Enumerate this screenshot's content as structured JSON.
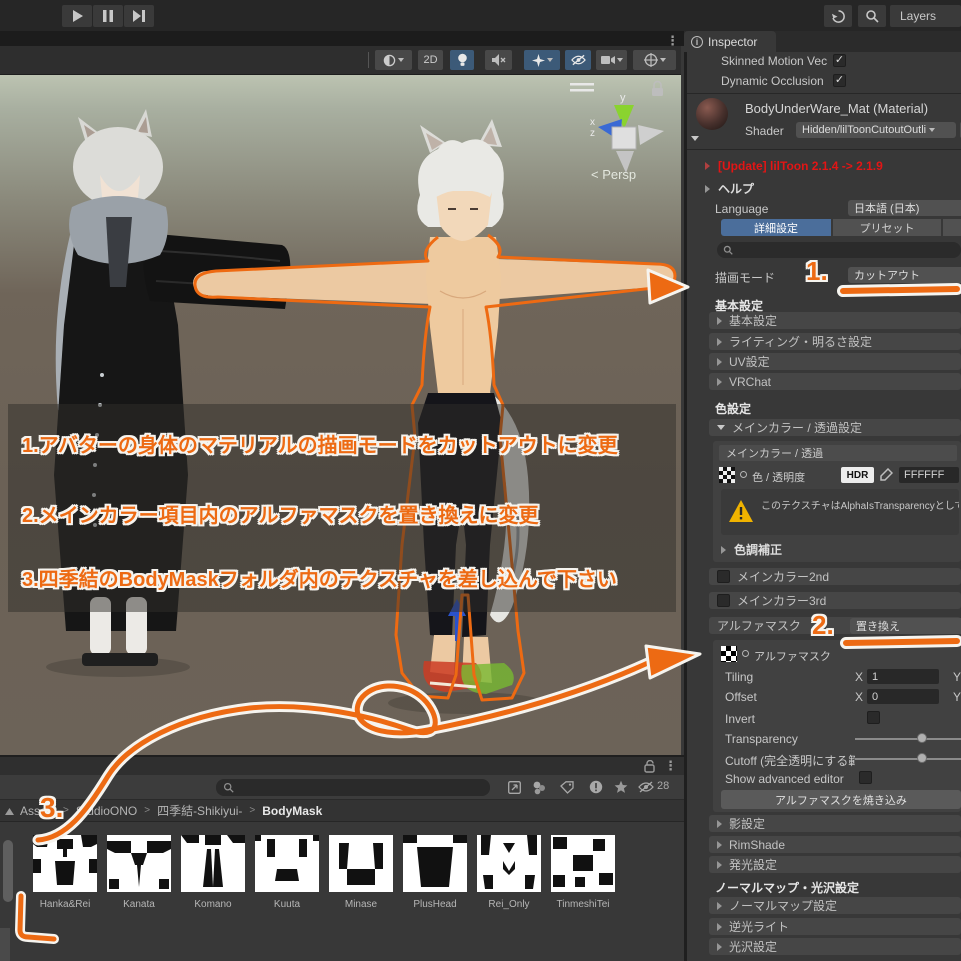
{
  "colors": {
    "accent_orange": "#ed6a13",
    "selected_blue": "#4b6e9b",
    "update_red": "#e31515",
    "warning_yellow": "#f0b300"
  },
  "top_bar": {
    "layers_label": "Layers"
  },
  "scene": {
    "mode_2d": "2D",
    "persp_label": "< Persp",
    "axis_y": "y",
    "axis_x": "x",
    "axis_z": "z"
  },
  "overlay": {
    "line1": "1.アバターの身体のマテリアルの描画モードをカットアウトに変更",
    "line2": "2.メインカラー項目内のアルファマスクを置き換えに変更",
    "line3": "3.四季結のBodyMaskフォルダ内のテクスチャを差し込んで下さい"
  },
  "annotations": {
    "step1": "1.",
    "step2": "2.",
    "step3": "3."
  },
  "inspector": {
    "tab": "Inspector",
    "skinned_motion_label": "Skinned Motion Vec",
    "dynamic_occlusion_label": "Dynamic Occlusion",
    "material_name": "BodyUnderWare_Mat (Material)",
    "shader_label": "Shader",
    "shader_value": "Hidden/lilToonCutoutOutli",
    "update_notice": "[Update] lilToon 2.1.4 -> 2.1.9",
    "help_label": "ヘルプ",
    "language_label": "Language",
    "language_value": "日本語 (日本)",
    "tab_detail": "詳細設定",
    "tab_preset": "プリセット",
    "rendering_mode_label": "描画モード",
    "rendering_mode_value": "カットアウト",
    "section_basic": "基本設定",
    "foldout_basic": "基本設定",
    "foldout_lighting": "ライティング・明るさ設定",
    "foldout_uv": "UV設定",
    "foldout_vrchat": "VRChat",
    "section_color": "色設定",
    "foldout_maincolor": "メインカラー / 透過設定",
    "maincolor_header": "メインカラー / 透過",
    "color_label": "色 / 透明度",
    "hdr_label": "HDR",
    "color_hex": "FFFFFF",
    "texture_warning": "このテクスチャはAlphaIsTransparencyとして設定",
    "tone_correction": "色調補正",
    "maincolor_2nd": "メインカラー2nd",
    "maincolor_3rd": "メインカラー3rd",
    "alphamask_label": "アルファマスク",
    "alphamask_mode": "置き換え",
    "alphamask_texture_label": "アルファマスク",
    "tiling_label": "Tiling",
    "offset_label": "Offset",
    "axis_x": "X",
    "axis_y": "Y",
    "tiling_x": "1",
    "offset_x": "0",
    "invert_label": "Invert",
    "transparency_label": "Transparency",
    "cutoff_label": "Cutoff (完全透明にする範",
    "show_advanced_label": "Show advanced editor",
    "bake_button": "アルファマスクを焼き込み",
    "foldout_shadow": "影設定",
    "foldout_rimshade": "RimShade",
    "foldout_emission": "発光設定",
    "section_normal": "ノーマルマップ・光沢設定",
    "foldout_normalmap": "ノーマルマップ設定",
    "foldout_backlight": "逆光ライト",
    "foldout_gloss": "光沢設定"
  },
  "project": {
    "breadcrumb": {
      "assets": "Assets",
      "studio": "StudioONO",
      "avatar": "四季結-Shikiyui-",
      "folder": "BodyMask"
    },
    "hidden_count": "28",
    "textures": [
      "Hanka&Rei",
      "Kanata",
      "Komano",
      "Kuuta",
      "Minase",
      "PlusHead",
      "Rei_Only",
      "TinmeshiTei"
    ]
  }
}
